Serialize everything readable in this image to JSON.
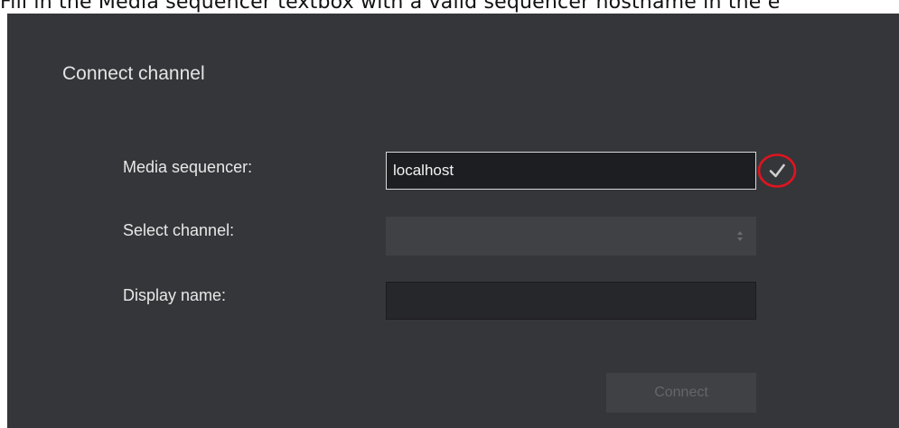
{
  "instruction": "Fill in the Media sequencer textbox with a valid sequencer hostname in the e",
  "dialog": {
    "title": "Connect channel",
    "media_sequencer": {
      "label": "Media sequencer:",
      "value": "localhost",
      "status": "valid"
    },
    "select_channel": {
      "label": "Select channel:",
      "value": ""
    },
    "display_name": {
      "label": "Display name:",
      "value": ""
    },
    "connect_label": "Connect"
  },
  "icons": {
    "validation": "checkmark-icon",
    "highlight": "red-circle-annotation",
    "select_arrows": "up-down-arrows-icon"
  },
  "colors": {
    "dialog_background": "#35363a",
    "input_background": "#1d1e22",
    "annotation": "#e0141e",
    "check": "#cfcfcf"
  }
}
